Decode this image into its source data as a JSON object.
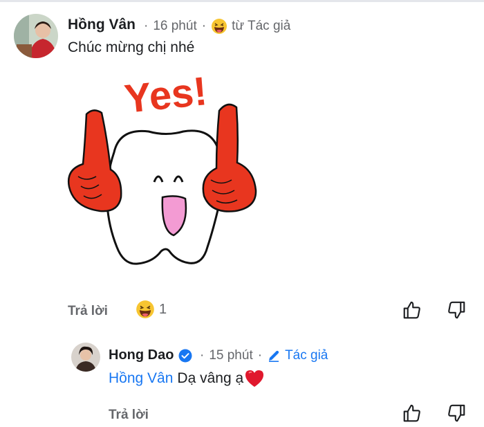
{
  "comment1": {
    "author": "Hồng Vân",
    "time": "16 phút",
    "fan_label": "từ Tác giả",
    "text": "Chúc mừng chị nhé",
    "sticker_text": "Yes!",
    "reply_label": "Trả lời",
    "reaction_count": "1",
    "reaction_icon": "grinning-squint-emoji-icon"
  },
  "comment2": {
    "author": "Hong Dao",
    "time": "15 phút",
    "author_badge": "Tác giả",
    "mention": "Hồng Vân",
    "text": "Dạ vâng ạ",
    "text_emoji": "heart-icon",
    "reply_label": "Trả lời"
  },
  "colors": {
    "link_blue": "#1877f2",
    "meta_gray": "#65676b",
    "sticker_red": "#e8361f",
    "heart_red": "#e0182d"
  }
}
